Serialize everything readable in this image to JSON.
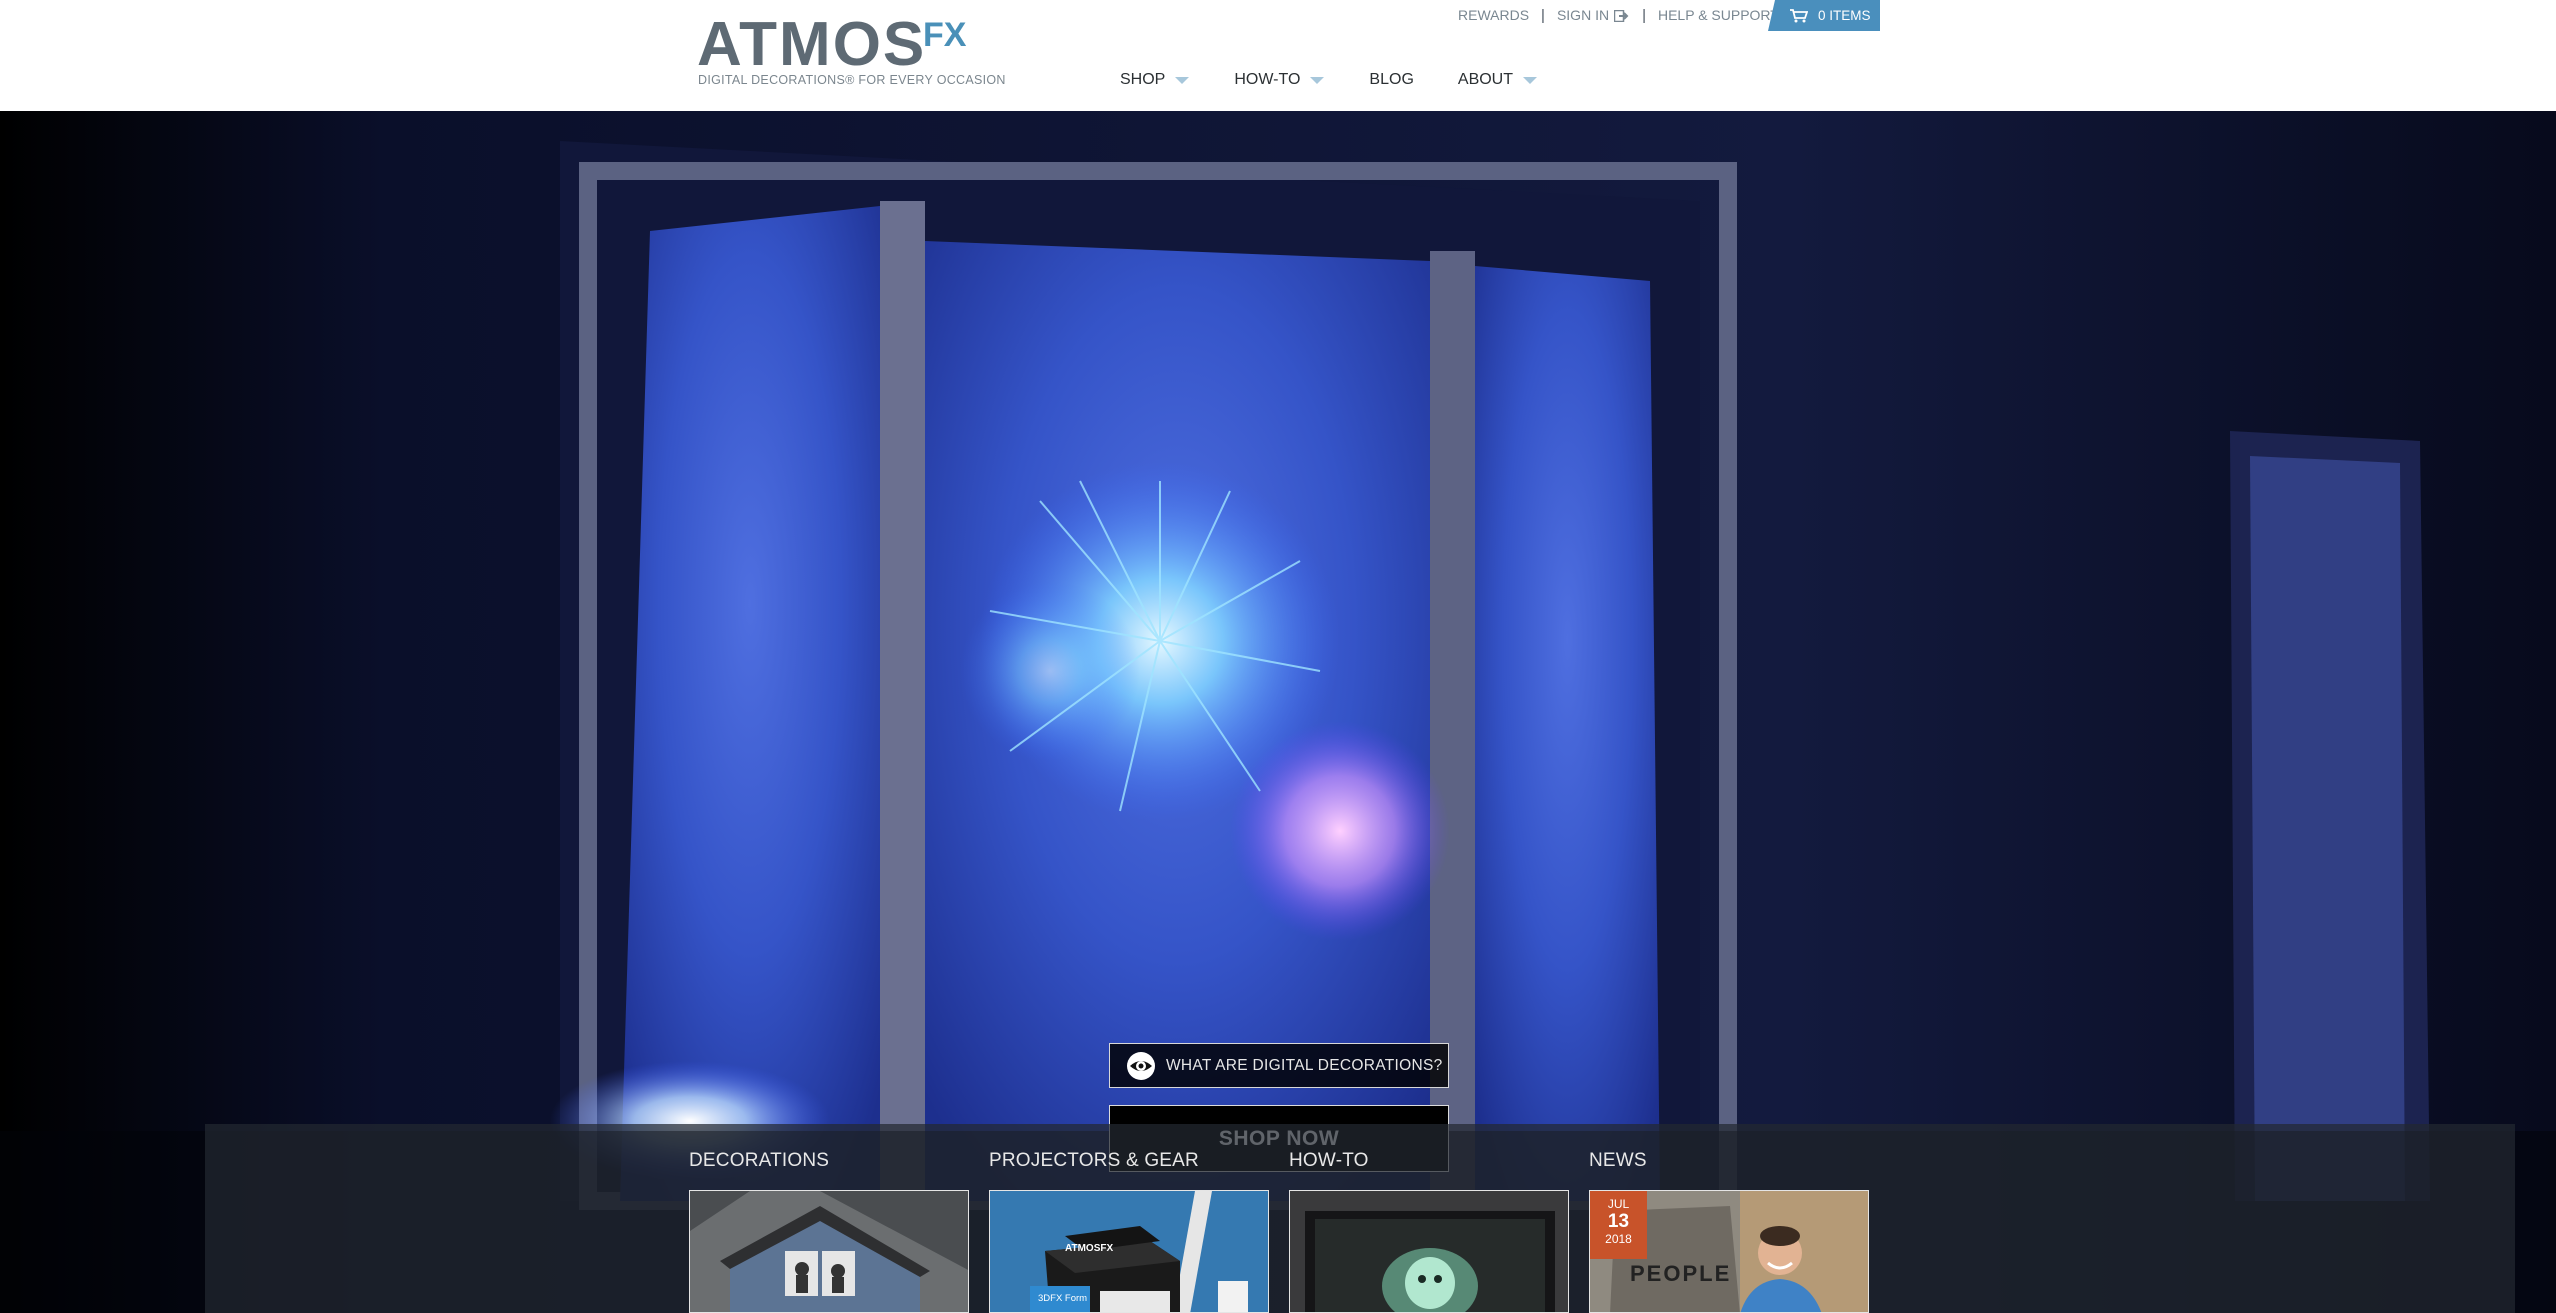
{
  "header": {
    "logo_main": "ATMOS",
    "logo_fx": "FX",
    "tagline": "DIGITAL DECORATIONS® FOR EVERY OCCASION",
    "utility": {
      "rewards": "REWARDS",
      "sign_in": "SIGN IN",
      "help": "HELP & SUPPORT",
      "separator": "|"
    },
    "cart": {
      "label": "0 ITEMS",
      "icon": "cart-icon"
    },
    "nav": [
      {
        "label": "SHOP",
        "has_dropdown": true
      },
      {
        "label": "HOW-TO",
        "has_dropdown": true
      },
      {
        "label": "BLOG",
        "has_dropdown": false
      },
      {
        "label": "ABOUT",
        "has_dropdown": true
      }
    ]
  },
  "hero": {
    "what_button": "WHAT ARE DIGITAL DECORATIONS?",
    "shop_button": "SHOP NOW"
  },
  "categories": [
    {
      "label": "DECORATIONS"
    },
    {
      "label": "PROJECTORS & GEAR",
      "product_label": "ATMOSFX",
      "product_sub": "3DFX Form"
    },
    {
      "label": "HOW-TO"
    },
    {
      "label": "NEWS",
      "date_month": "JUL",
      "date_day": "13",
      "date_year": "2018",
      "poster_text": "PEOPLE"
    }
  ],
  "colors": {
    "accent": "#4a8fbd",
    "logo_gray": "#5e6a74",
    "news_badge": "#c8532a"
  }
}
